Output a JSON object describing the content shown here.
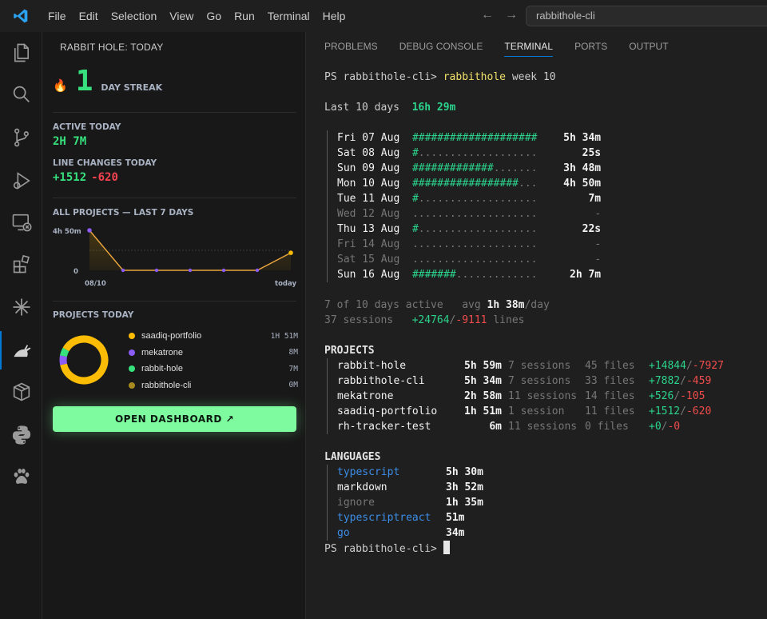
{
  "menu": [
    "File",
    "Edit",
    "Selection",
    "View",
    "Go",
    "Run",
    "Terminal",
    "Help"
  ],
  "command_center": "rabbithole-cli",
  "sidebar": {
    "title": "RABBIT HOLE: TODAY",
    "streak_value": "1",
    "streak_label": "DAY STREAK",
    "active_label": "ACTIVE TODAY",
    "active_value": "2H 7M",
    "changes_label": "LINE CHANGES TODAY",
    "changes_added": "+1512",
    "changes_removed": "-620",
    "all_projects_label": "ALL PROJECTS — LAST 7 DAYS",
    "projects_today_label": "PROJECTS TODAY",
    "projects_today": [
      {
        "name": "saadiq-portfolio",
        "value": "1H 51M",
        "color": "#fbbc05"
      },
      {
        "name": "mekatrone",
        "value": "8M",
        "color": "#8b5cf6"
      },
      {
        "name": "rabbit-hole",
        "value": "7M",
        "color": "#37e27e"
      },
      {
        "name": "rabbithole-cli",
        "value": "0M",
        "color": "#a78a1f"
      }
    ],
    "dashboard_button": "OPEN DASHBOARD ↗"
  },
  "chart_data": {
    "type": "line",
    "x": [
      "08/10",
      "",
      "",
      "",
      "",
      "",
      "today"
    ],
    "values_minutes": [
      290,
      0,
      0,
      0,
      0,
      0,
      127
    ],
    "ytick_top": "4h 50m",
    "ytick_bottom": "0",
    "xtick_first": "08/10",
    "xtick_last": "today",
    "ylim": [
      0,
      290
    ]
  },
  "panel": {
    "tabs": [
      "PROBLEMS",
      "DEBUG CONSOLE",
      "TERMINAL",
      "PORTS",
      "OUTPUT"
    ],
    "active_tab": "TERMINAL"
  },
  "terminal": {
    "prompt": "PS rabbithole-cli> ",
    "command": "rabbithole",
    "command_args": " week 10",
    "summary_label": "Last 10 days",
    "summary_value": "16h 29m",
    "days": [
      {
        "day": "Fri 07 Aug",
        "bar_filled": "####################",
        "bar_empty": "",
        "time": "5h 34m",
        "muted": false
      },
      {
        "day": "Sat 08 Aug",
        "bar_filled": "#",
        "bar_empty": "...................",
        "time": "25s",
        "muted": false
      },
      {
        "day": "Sun 09 Aug",
        "bar_filled": "#############",
        "bar_empty": ".......",
        "time": "3h 48m",
        "muted": false
      },
      {
        "day": "Mon 10 Aug",
        "bar_filled": "#################",
        "bar_empty": "...",
        "time": "4h 50m",
        "muted": false
      },
      {
        "day": "Tue 11 Aug",
        "bar_filled": "#",
        "bar_empty": "...................",
        "time": "7m",
        "muted": false
      },
      {
        "day": "Wed 12 Aug",
        "bar_filled": "",
        "bar_empty": "....................",
        "time": "-",
        "muted": true
      },
      {
        "day": "Thu 13 Aug",
        "bar_filled": "#",
        "bar_empty": "...................",
        "time": "22s",
        "muted": false
      },
      {
        "day": "Fri 14 Aug",
        "bar_filled": "",
        "bar_empty": "....................",
        "time": "-",
        "muted": true
      },
      {
        "day": "Sat 15 Aug",
        "bar_filled": "",
        "bar_empty": "....................",
        "time": "-",
        "muted": true
      },
      {
        "day": "Sun 16 Aug",
        "bar_filled": "#######",
        "bar_empty": ".............",
        "time": "2h 7m",
        "muted": false
      }
    ],
    "stats_active": "7 of 10 days active",
    "stats_avg_label": "avg",
    "stats_avg_value": "1h 38m",
    "stats_avg_unit": "/day",
    "stats_sessions": "37 sessions",
    "stats_added": "+24764",
    "stats_removed": "-9111",
    "stats_lines": "lines",
    "projects_header": "PROJECTS",
    "projects": [
      {
        "name": "rabbit-hole",
        "time": "5h 59m",
        "sessions": "7 sessions",
        "files": "45 files",
        "added": "+14844",
        "removed": "-7927"
      },
      {
        "name": "rabbithole-cli",
        "time": "5h 34m",
        "sessions": "7 sessions",
        "files": "33 files",
        "added": "+7882",
        "removed": "-459"
      },
      {
        "name": "mekatrone",
        "time": "2h 58m",
        "sessions": "11 sessions",
        "files": "14 files",
        "added": "+526",
        "removed": "-105"
      },
      {
        "name": "saadiq-portfolio",
        "time": "1h 51m",
        "sessions": "1 session",
        "files": "11 files",
        "added": "+1512",
        "removed": "-620"
      },
      {
        "name": "rh-tracker-test",
        "time": "6m",
        "sessions": "11 sessions",
        "files": "0 files",
        "added": "+0",
        "removed": "-0"
      }
    ],
    "languages_header": "LANGUAGES",
    "languages": [
      {
        "name": "typescript",
        "time": "5h 30m",
        "tone": "blue"
      },
      {
        "name": "markdown",
        "time": "3h 52m",
        "tone": "white"
      },
      {
        "name": "ignore",
        "time": "1h 35m",
        "tone": "dim"
      },
      {
        "name": "typescriptreact",
        "time": "51m",
        "tone": "blue"
      },
      {
        "name": "go",
        "time": "34m",
        "tone": "blue"
      }
    ],
    "final_prompt": "PS rabbithole-cli> "
  }
}
